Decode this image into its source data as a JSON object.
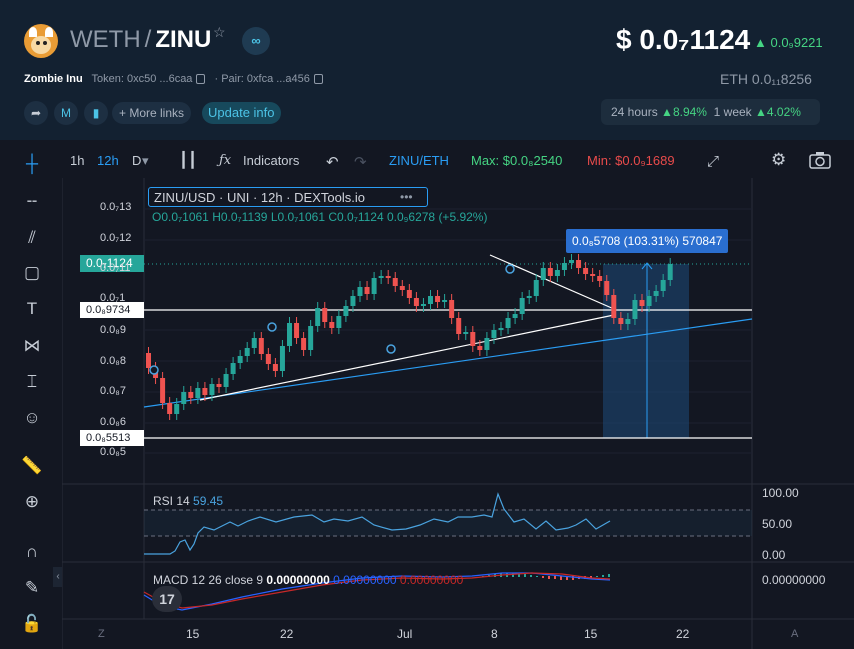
{
  "header": {
    "base_token": "WETH",
    "quote_token": "ZINU",
    "price": "$ 0.0₇1124",
    "price_change": "0.0₉9221",
    "token_name": "Zombie Inu",
    "token_label": "Token: 0xc50 ...6caa",
    "pair_label": "· Pair: 0xfca ...a456",
    "eth_price": "ETH  0.0₁₁8256",
    "more_links": "More links",
    "update_info": "Update info",
    "period_24h_label": "24 hours",
    "period_24h_value": "8.94%",
    "period_1w_label": "1 week",
    "period_1w_value": "4.02%"
  },
  "toolbar": {
    "tf_1h": "1h",
    "tf_12h": "12h",
    "tf_d": "D",
    "indicators": "Indicators",
    "pair": "ZINU/ETH",
    "max": "Max: $0.0₈2540",
    "min": "Min: $0.0₉1689"
  },
  "chart": {
    "legend_title": "ZINU/USD · UNI · 12h · DEXTools.io",
    "ohlc_o": "O0.0₇1061",
    "ohlc_h": "H0.0₇1139",
    "ohlc_l": "L0.0₇1061",
    "ohlc_c": "C0.0₇1124",
    "ohlc_chg": "0.0₉6278 (+5.92%)",
    "measure_label": "0.0₈5708 (103.31%) 570847",
    "price_tag_current": "0.0₇1124",
    "price_tag_top": "0.0₈9734",
    "price_tag_bottom": "0.0₈5513",
    "rsi_label": "RSI 14",
    "rsi_value": "59.45",
    "macd_label": "MACD 12 26 close 9",
    "macd_v1": "0.00000000",
    "macd_v2": "0.00000000",
    "macd_v3": "0.00000000",
    "macd_axis": "0.00000000",
    "rsi_ticks": [
      "100.00",
      "50.00",
      "0.00"
    ],
    "price_ticks": [
      "0.0₇13",
      "0.0₇12",
      "0.0₇11",
      "0.0₇1",
      "0.0₈9",
      "0.0₈8",
      "0.0₈7",
      "0.0₈6",
      "0.0₈5"
    ],
    "x_ticks": [
      "15",
      "22",
      "Jul",
      "8",
      "15",
      "22"
    ],
    "corner_left": "Z",
    "corner_right": "A",
    "tv_logo": "17"
  },
  "colors": {
    "up": "#26a69a",
    "down": "#ef5350",
    "accent": "#2a9df4",
    "rsi": "#4aa3df"
  },
  "chart_data": {
    "type": "candlestick",
    "pair": "ZINU/USD",
    "interval": "12h",
    "last_close": 1.124e-07
  }
}
